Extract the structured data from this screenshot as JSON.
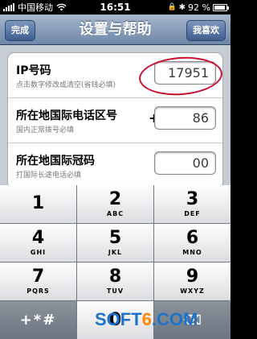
{
  "status": {
    "carrier": "中国移动",
    "time": "16:51",
    "battery": "92 %",
    "battery_level": 0.92
  },
  "navbar": {
    "left_button": "完成",
    "title": "设置与帮助",
    "right_button": "我喜欢"
  },
  "settings": [
    {
      "label": "IP号码",
      "hint": "点击数字修改或清空(省钱必填)",
      "prefix": "",
      "value": "17951"
    },
    {
      "label": "所在地国际电话区号",
      "hint": "国内正常拨号必填",
      "prefix": "+",
      "value": "86"
    },
    {
      "label": "所在地国际冠码",
      "hint": "打国际长途电话必填",
      "prefix": "",
      "value": "00"
    }
  ],
  "keypad": {
    "keys": [
      {
        "digit": "1",
        "letters": ""
      },
      {
        "digit": "2",
        "letters": "ABC"
      },
      {
        "digit": "3",
        "letters": "DEF"
      },
      {
        "digit": "4",
        "letters": "GHI"
      },
      {
        "digit": "5",
        "letters": "JKL"
      },
      {
        "digit": "6",
        "letters": "MNO"
      },
      {
        "digit": "7",
        "letters": "PQRS"
      },
      {
        "digit": "8",
        "letters": "TUV"
      },
      {
        "digit": "9",
        "letters": "WXYZ"
      }
    ],
    "symbols": "+*#",
    "zero": "0"
  },
  "watermark": {
    "part1": "SOFT",
    "part2": "6",
    "part3": ".COM"
  }
}
